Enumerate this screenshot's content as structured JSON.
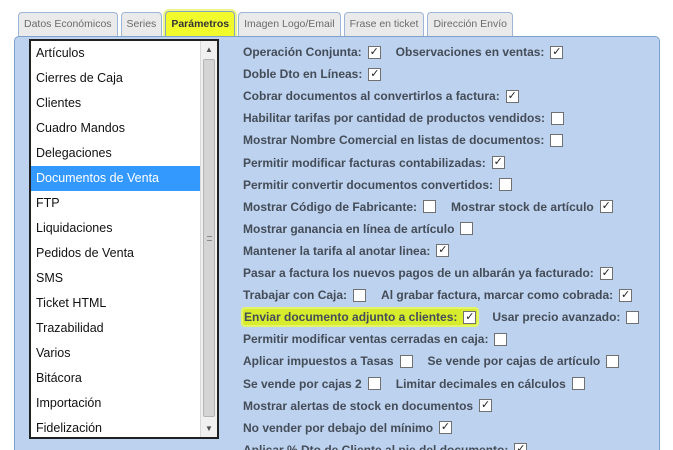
{
  "tabs": [
    {
      "label": "Datos Económicos",
      "active": false
    },
    {
      "label": "Series",
      "active": false
    },
    {
      "label": "Parámetros",
      "active": true
    },
    {
      "label": "Imagen Logo/Email",
      "active": false
    },
    {
      "label": "Frase en ticket",
      "active": false
    },
    {
      "label": "Dirección Envío",
      "active": false
    }
  ],
  "sections": {
    "selected": "Documentos de Venta",
    "items": [
      "Artículos",
      "Cierres de Caja",
      "Clientes",
      "Cuadro Mandos",
      "Delegaciones",
      "Documentos de Venta",
      "FTP",
      "Liquidaciones",
      "Pedidos de Venta",
      "SMS",
      "Ticket HTML",
      "Trazabilidad",
      "Varios",
      "Bitácora",
      "Importación",
      "Fidelización"
    ]
  },
  "check_glyph": "✓",
  "highlight_color": "#d8ec2e",
  "options": [
    [
      {
        "label": "Operación Conjunta:",
        "checked": true
      },
      {
        "label": "Observaciones en ventas:",
        "checked": true
      }
    ],
    [
      {
        "label": "Doble Dto en Líneas:",
        "checked": true
      }
    ],
    [
      {
        "label": "Cobrar documentos al convertirlos a factura:",
        "checked": true
      }
    ],
    [
      {
        "label": "Habilitar tarifas por cantidad de productos vendidos:",
        "checked": false
      }
    ],
    [
      {
        "label": "Mostrar Nombre Comercial en listas de documentos:",
        "checked": false
      }
    ],
    [
      {
        "label": "Permitir modificar facturas contabilizadas:",
        "checked": true
      }
    ],
    [
      {
        "label": "Permitir convertir documentos convertidos:",
        "checked": false
      }
    ],
    [
      {
        "label": "Mostrar Código de Fabricante:",
        "checked": false
      },
      {
        "label": "Mostrar stock de artículo",
        "checked": true
      }
    ],
    [
      {
        "label": "Mostrar ganancia en línea de artículo",
        "checked": false
      }
    ],
    [
      {
        "label": "Mantener la tarifa al anotar linea:",
        "checked": true
      }
    ],
    [
      {
        "label": "Pasar a factura los nuevos pagos de un albarán ya facturado:",
        "checked": true
      }
    ],
    [
      {
        "label": "Trabajar con Caja:",
        "checked": false
      },
      {
        "label": "Al grabar factura, marcar como cobrada:",
        "checked": true
      }
    ],
    [
      {
        "label": "Enviar documento adjunto a clientes:",
        "checked": true,
        "highlighted": true
      },
      {
        "label": "Usar precio avanzado:",
        "checked": false
      }
    ],
    [
      {
        "label": "Permitir modificar ventas cerradas en caja:",
        "checked": false
      }
    ],
    [
      {
        "label": "Aplicar impuestos a Tasas",
        "checked": false
      },
      {
        "label": "Se vende por cajas de artículo",
        "checked": false
      }
    ],
    [
      {
        "label": "Se vende por cajas 2",
        "checked": false
      },
      {
        "label": "Limitar decimales en cálculos",
        "checked": false
      }
    ],
    [
      {
        "label": "Mostrar alertas de stock en documentos",
        "checked": true
      }
    ],
    [
      {
        "label": "No vender por debajo del mínimo",
        "checked": true
      }
    ],
    [
      {
        "label": "Aplicar % Dto de Cliente al pie del documento:",
        "checked": true
      }
    ]
  ]
}
